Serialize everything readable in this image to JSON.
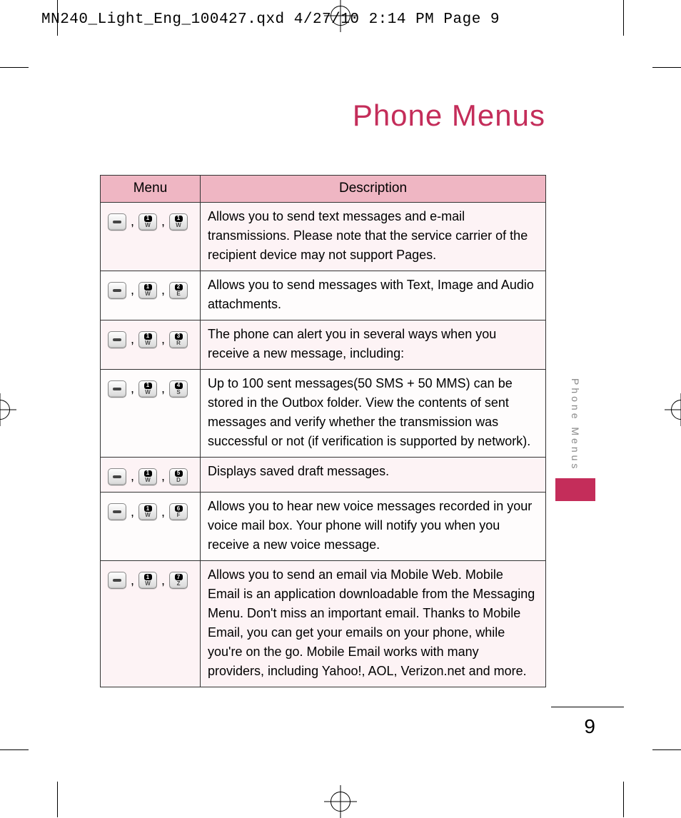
{
  "slug_line": "MN240_Light_Eng_100427.qxd  4/27/10  2:14 PM  Page 9",
  "page_title": "Phone Menus",
  "side_tab_label": "Phone Menus",
  "page_number": "9",
  "table": {
    "header_menu": "Menu",
    "header_desc": "Description",
    "rows": [
      {
        "keys": [
          {
            "type": "soft"
          },
          {
            "type": "numpad",
            "num": "1",
            "let": "W"
          },
          {
            "type": "numpad",
            "num": "1",
            "let": "W"
          }
        ],
        "desc": "Allows you to send text messages and e-mail transmissions. Please note that the service carrier of the recipient device may not support Pages."
      },
      {
        "keys": [
          {
            "type": "soft"
          },
          {
            "type": "numpad",
            "num": "1",
            "let": "W"
          },
          {
            "type": "numpad",
            "num": "2",
            "let": "E"
          }
        ],
        "desc": "Allows you to send messages with Text, Image and Audio attachments."
      },
      {
        "keys": [
          {
            "type": "soft"
          },
          {
            "type": "numpad",
            "num": "1",
            "let": "W"
          },
          {
            "type": "numpad",
            "num": "3",
            "let": "R"
          }
        ],
        "desc": "The phone can alert you in several ways when you receive a new message, including:"
      },
      {
        "keys": [
          {
            "type": "soft"
          },
          {
            "type": "numpad",
            "num": "1",
            "let": "W"
          },
          {
            "type": "numpad",
            "num": "4",
            "let": "S"
          }
        ],
        "desc": "Up to 100 sent messages(50 SMS + 50 MMS) can be stored in the Outbox folder. View the contents of sent messages and verify whether the transmission was successful or not (if verification is supported by network)."
      },
      {
        "keys": [
          {
            "type": "soft"
          },
          {
            "type": "numpad",
            "num": "1",
            "let": "W"
          },
          {
            "type": "numpad",
            "num": "5",
            "let": "D"
          }
        ],
        "desc": "Displays saved draft messages."
      },
      {
        "keys": [
          {
            "type": "soft"
          },
          {
            "type": "numpad",
            "num": "1",
            "let": "W"
          },
          {
            "type": "numpad",
            "num": "6",
            "let": "F"
          }
        ],
        "desc": "Allows you to hear new voice messages recorded in your voice mail box. Your phone will notify you when you receive a new voice message."
      },
      {
        "keys": [
          {
            "type": "soft"
          },
          {
            "type": "numpad",
            "num": "1",
            "let": "W"
          },
          {
            "type": "numpad",
            "num": "7",
            "let": "Z"
          }
        ],
        "desc": "Allows you to send an email via Mobile Web. Mobile Email is an application downloadable from the Messaging Menu. Don't miss an important email. Thanks to Mobile Email, you can get your emails on your phone, while you're on the go. Mobile Email works with many providers, including Yahoo!, AOL, Verizon.net and more."
      }
    ]
  }
}
